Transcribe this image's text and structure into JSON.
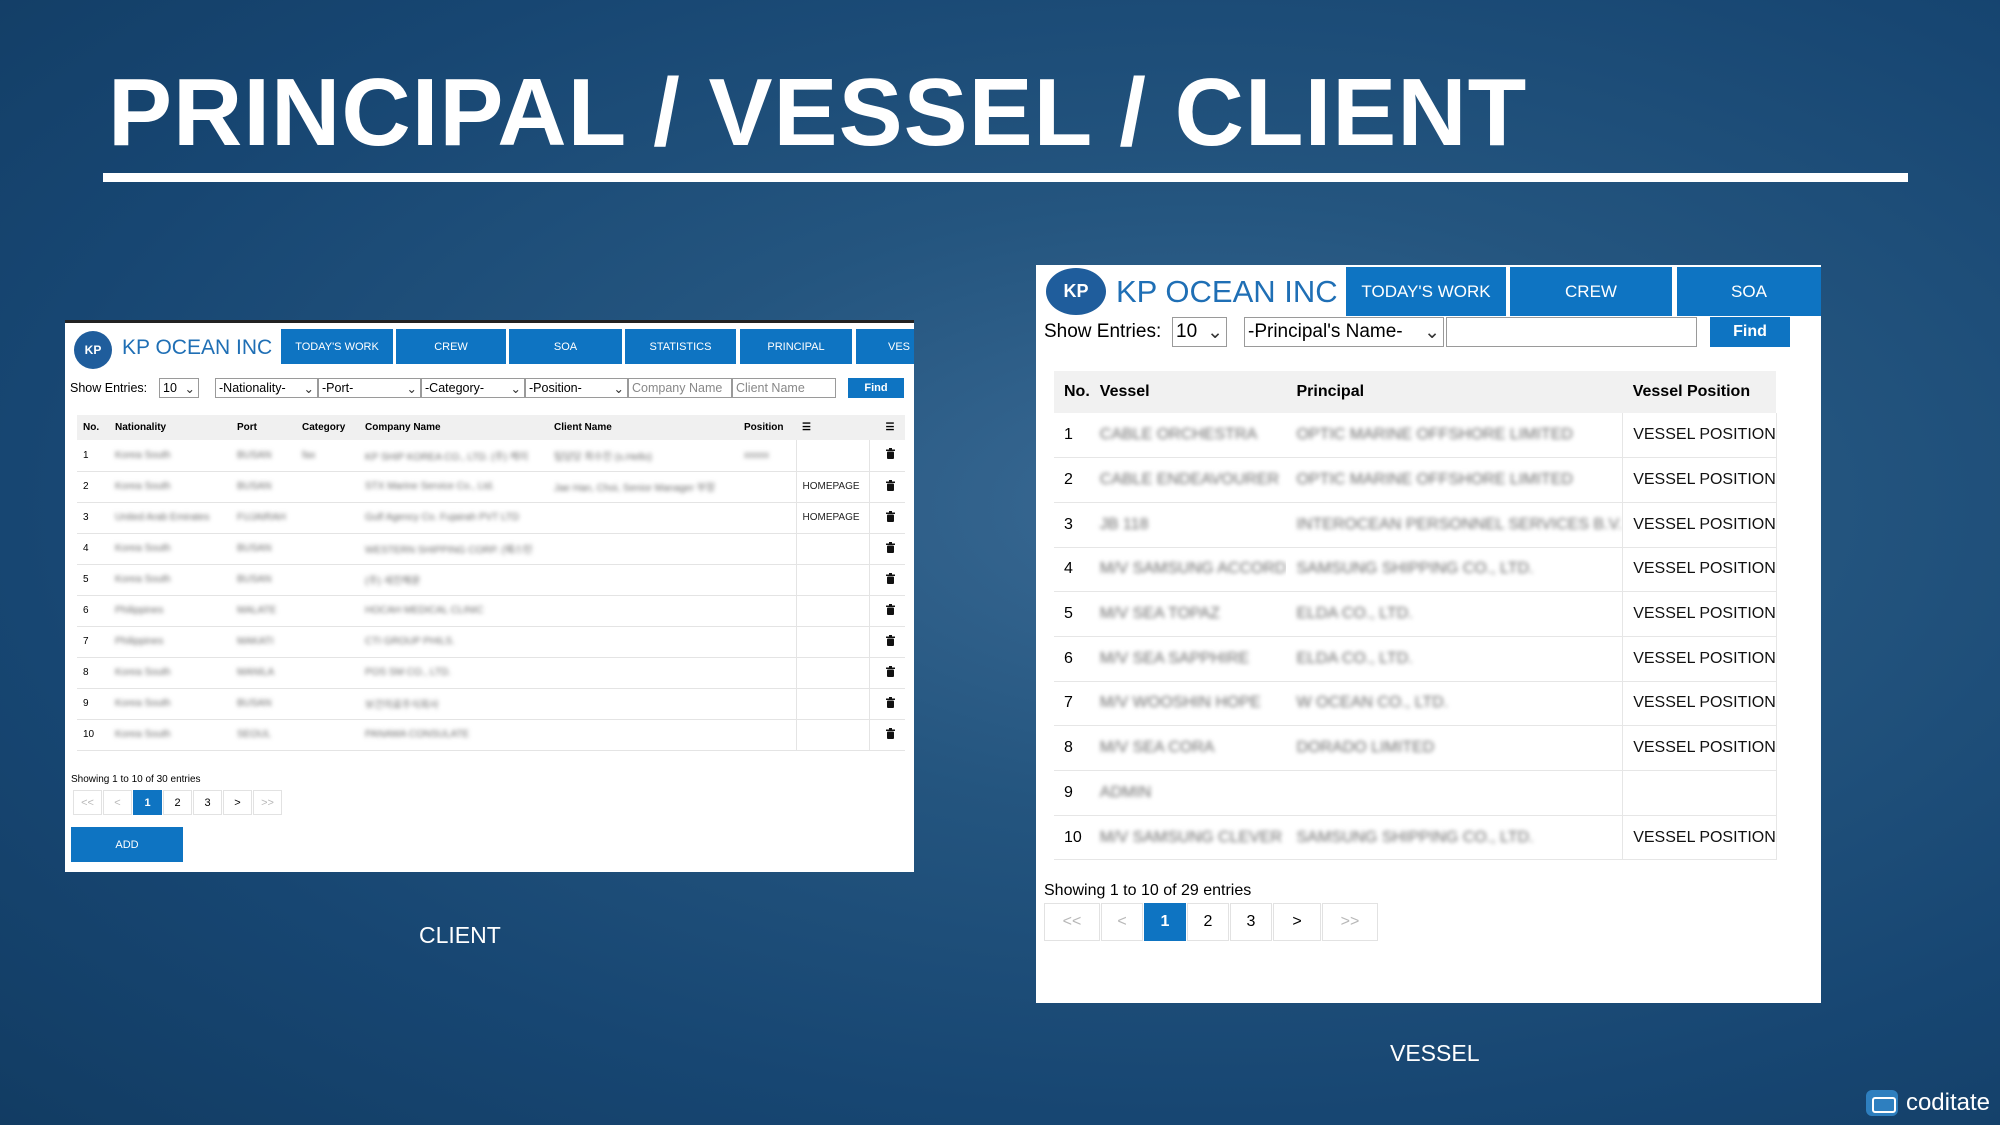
{
  "slide": {
    "title": "PRINCIPAL / VESSEL / CLIENT",
    "caption_client": "CLIENT",
    "caption_vessel": "VESSEL",
    "brand": "coditate"
  },
  "client": {
    "logo_mark": "KP",
    "logo_sub": "KP OCEAN INC.",
    "logo_text": "KP OCEAN INC",
    "nav": [
      "TODAY'S WORK",
      "CREW",
      "SOA",
      "STATISTICS",
      "PRINCIPAL",
      "VES"
    ],
    "show_entries_label": "Show Entries:",
    "entries_value": "10",
    "nationality_select": "-Nationality-",
    "port_select": "-Port-",
    "category_select": "-Category-",
    "position_select": "-Position-",
    "company_placeholder": "Company Name",
    "client_placeholder": "Client Name",
    "find_label": "Find",
    "columns": [
      "No.",
      "Nationality",
      "Port",
      "Category",
      "Company Name",
      "Client Name",
      "Position"
    ],
    "menu_icon": "hamburger-icon",
    "rows": [
      {
        "no": "1",
        "nat": "Korea South",
        "port": "BUSAN",
        "cat": "fax",
        "company": "KP SHIP KOREA CO., LTD. (주) 케이",
        "client": "팀담당 최수진 (s.Hello)",
        "position": "xxxxx",
        "home": ""
      },
      {
        "no": "2",
        "nat": "Korea South",
        "port": "BUSAN",
        "cat": "",
        "company": "STX Marine Service Co., Ltd.",
        "client": "Jae Han, Choi, Senior Manager 부장",
        "position": "",
        "home": "HOMEPAGE"
      },
      {
        "no": "3",
        "nat": "United Arab Emirates",
        "port": "FUJAIRAH",
        "cat": "",
        "company": "Gulf Agency Co. Fujairah PVT LTD",
        "client": "",
        "position": "",
        "home": "HOMEPAGE"
      },
      {
        "no": "4",
        "nat": "Korea South",
        "port": "BUSAN",
        "cat": "",
        "company": "WESTERN SHIPPING CORP. (웨스턴",
        "client": "",
        "position": "",
        "home": ""
      },
      {
        "no": "5",
        "nat": "Korea South",
        "port": "BUSAN",
        "cat": "",
        "company": "(주) 세진해운",
        "client": "",
        "position": "",
        "home": ""
      },
      {
        "no": "6",
        "nat": "Philippines",
        "port": "MALATE",
        "cat": "",
        "company": "HOCAH MEDICAL CLINIC",
        "client": "",
        "position": "",
        "home": ""
      },
      {
        "no": "7",
        "nat": "Philippines",
        "port": "MAKATI",
        "cat": "",
        "company": "CTI GROUP PHILS.",
        "client": "",
        "position": "",
        "home": ""
      },
      {
        "no": "8",
        "nat": "Korea South",
        "port": "MANILA",
        "cat": "",
        "company": "POS SM CO., LTD.",
        "client": "",
        "position": "",
        "home": ""
      },
      {
        "no": "9",
        "nat": "Korea South",
        "port": "BUSAN",
        "cat": "",
        "company": "보건의료주식회사",
        "client": "",
        "position": "",
        "home": ""
      },
      {
        "no": "10",
        "nat": "Korea South",
        "port": "SEOUL",
        "cat": "",
        "company": "PANAMA CONSULATE",
        "client": "",
        "position": "",
        "home": ""
      }
    ],
    "trash_icon": "trash-icon",
    "summary": "Showing 1 to 10 of 30 entries",
    "pager": [
      "<<",
      "<",
      "1",
      "2",
      "3",
      ">",
      ">>"
    ],
    "add_label": "ADD"
  },
  "vessel": {
    "logo_mark": "KP",
    "logo_sub": "KP OCEAN INC.",
    "logo_text": "KP OCEAN INC",
    "nav": [
      "TODAY'S WORK",
      "CREW",
      "SOA"
    ],
    "show_entries_label": "Show Entries:",
    "entries_value": "10",
    "principal_select": "-Principal's Name-",
    "search_value": "",
    "find_label": "Find",
    "columns": [
      "No.",
      "Vessel",
      "Principal",
      "Vessel Position"
    ],
    "rows": [
      {
        "no": "1",
        "vessel": "CABLE ORCHESTRA",
        "principal": "OPTIC MARINE OFFSHORE LIMITED",
        "position": "VESSEL POSITION"
      },
      {
        "no": "2",
        "vessel": "CABLE ENDEAVOURER",
        "principal": "OPTIC MARINE OFFSHORE LIMITED",
        "position": "VESSEL POSITION"
      },
      {
        "no": "3",
        "vessel": "JB 118",
        "principal": "INTEROCEAN PERSONNEL SERVICES B.V.",
        "position": "VESSEL POSITION"
      },
      {
        "no": "4",
        "vessel": "M/V SAMSUNG ACCORD",
        "principal": "SAMSUNG SHIPPING CO., LTD.",
        "position": "VESSEL POSITION"
      },
      {
        "no": "5",
        "vessel": "M/V SEA TOPAZ",
        "principal": "ELDA CO., LTD.",
        "position": "VESSEL POSITION"
      },
      {
        "no": "6",
        "vessel": "M/V SEA SAPPHIRE",
        "principal": "ELDA CO., LTD.",
        "position": "VESSEL POSITION"
      },
      {
        "no": "7",
        "vessel": "M/V WOOSHIN HOPE",
        "principal": "W OCEAN CO., LTD.",
        "position": "VESSEL POSITION"
      },
      {
        "no": "8",
        "vessel": "M/V SEA CORA",
        "principal": "DORADO LIMITED",
        "position": "VESSEL POSITION"
      },
      {
        "no": "9",
        "vessel": "ADMIN",
        "principal": "",
        "position": ""
      },
      {
        "no": "10",
        "vessel": "M/V SAMSUNG CLEVER",
        "principal": "SAMSUNG SHIPPING CO., LTD.",
        "position": "VESSEL POSITION"
      }
    ],
    "summary": "Showing 1 to 10 of 29 entries",
    "pager": [
      "<<",
      "<",
      "1",
      "2",
      "3",
      ">",
      ">>"
    ]
  }
}
